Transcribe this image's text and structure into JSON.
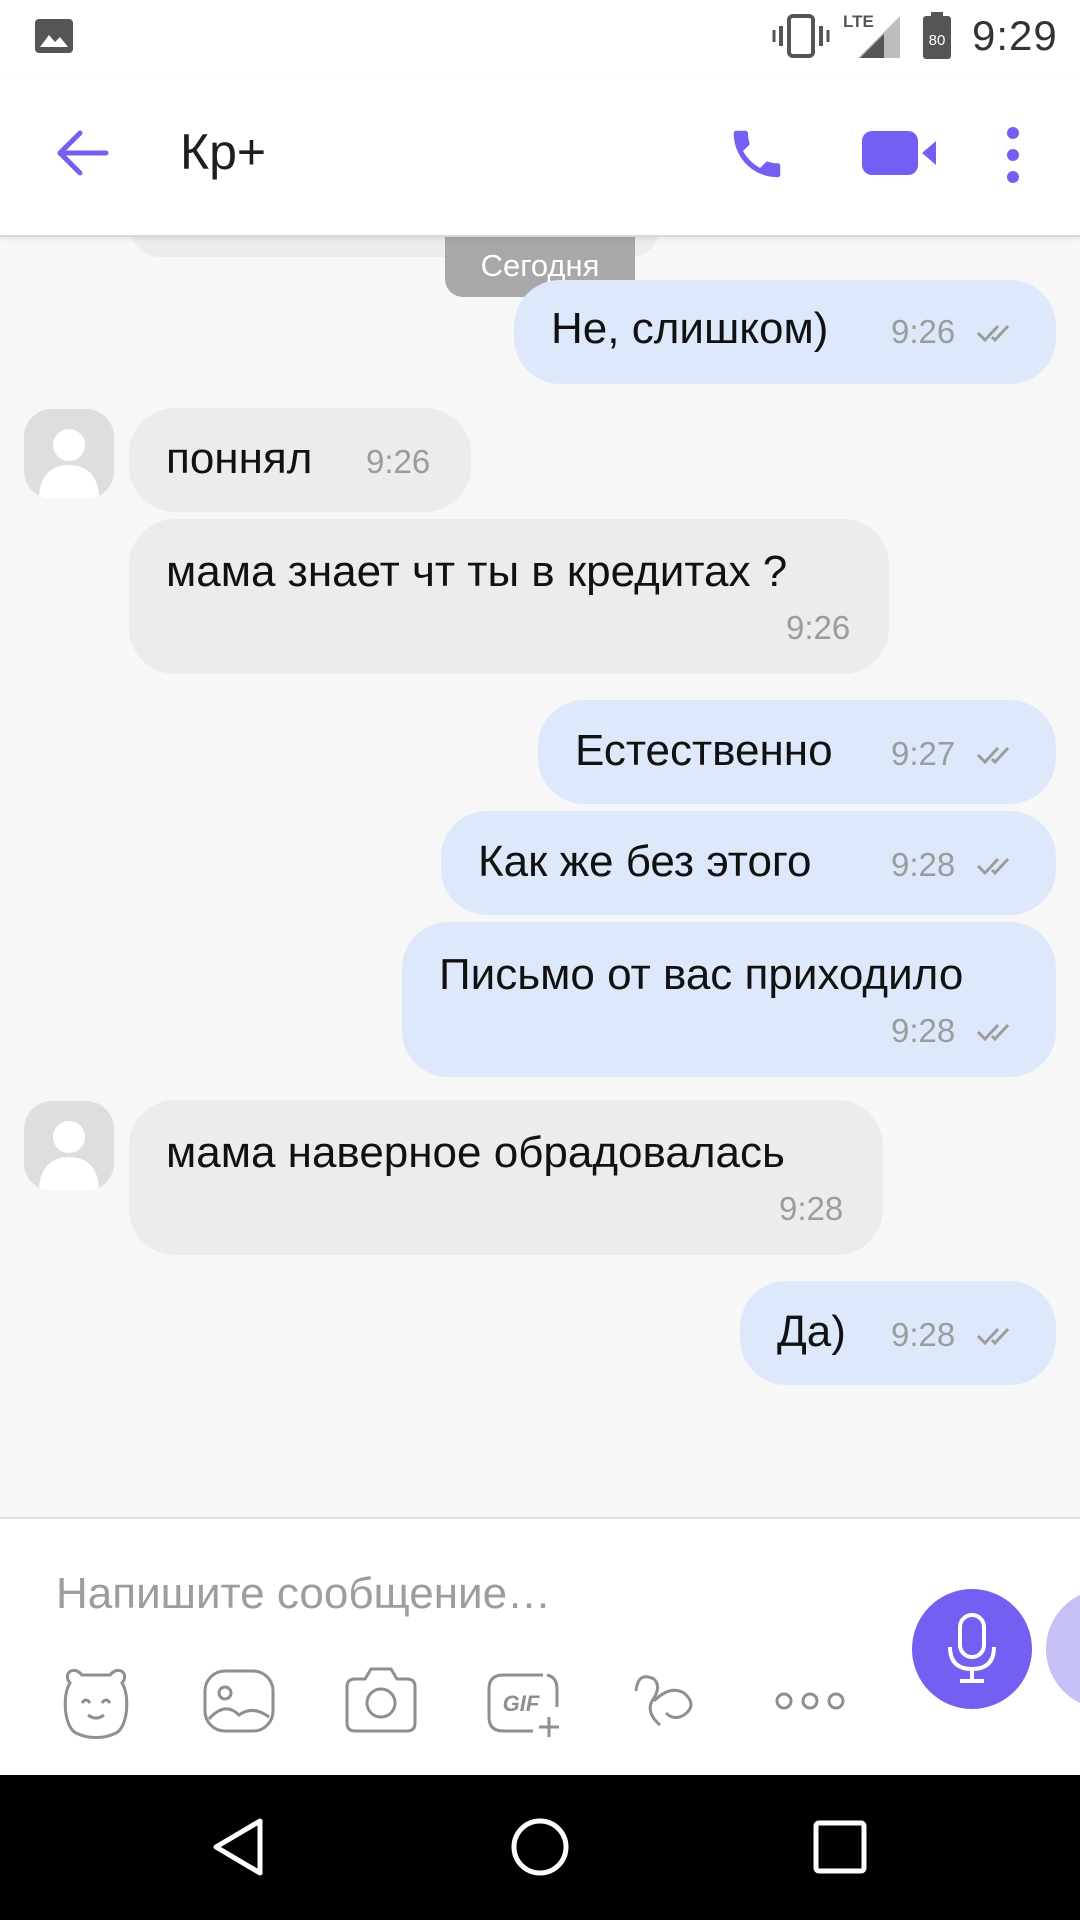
{
  "status_bar": {
    "time": "9:29",
    "network": "LTE",
    "battery": "80",
    "icons": [
      "gallery-icon",
      "vibrate-icon",
      "signal-icon",
      "battery-icon"
    ]
  },
  "header": {
    "title": "Кр+",
    "icons": [
      "back-arrow-icon",
      "phone-icon",
      "video-camera-icon",
      "more-vert-icon"
    ]
  },
  "chat": {
    "date_chip": "Сегодня",
    "messages": [
      {
        "direction": "out",
        "text": "Не, слишком)",
        "time": "9:26",
        "status": "double-check"
      },
      {
        "direction": "in",
        "text": "поннял",
        "time": "9:26"
      },
      {
        "direction": "in",
        "text": "мама знает чт ты в кредитах ?",
        "time": "9:26"
      },
      {
        "direction": "out",
        "text": "Естественно",
        "time": "9:27",
        "status": "double-check"
      },
      {
        "direction": "out",
        "text": "Как же без этого",
        "time": "9:28",
        "status": "double-check"
      },
      {
        "direction": "out",
        "text": "Письмо от вас приходило",
        "time": "9:28",
        "status": "double-check"
      },
      {
        "direction": "in",
        "text": "мама наверное обрадовалась",
        "time": "9:28"
      },
      {
        "direction": "out",
        "text": "Да)",
        "time": "9:28",
        "status": "double-check"
      }
    ]
  },
  "composer": {
    "placeholder": "Напишите сообщение…",
    "tools": [
      "sticker-icon",
      "gallery-icon",
      "camera-icon",
      "gif-icon",
      "doodle-icon",
      "more-horiz-icon"
    ],
    "action": "microphone-icon"
  },
  "nav_bar": {
    "buttons": [
      "back-triangle-icon",
      "home-circle-icon",
      "recents-square-icon"
    ]
  },
  "colors": {
    "accent": "#7360f2",
    "outgoing_bubble": "#dde9fb",
    "incoming_bubble": "#ececed",
    "chat_background": "#f7f7f8"
  }
}
